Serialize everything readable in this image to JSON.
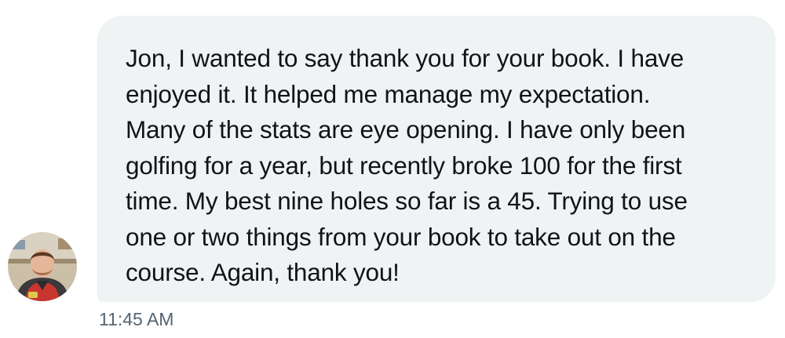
{
  "message": {
    "lines": [
      "Jon, I wanted to say thank you for your book. I have",
      "enjoyed it. It helped me manage my expectation.",
      "Many of the stats are eye opening. I have only been",
      "golfing for a year, but recently broke 100 for the first",
      "time. My best nine holes so far is a 45. Trying to use",
      "one or two things from your book to take out on the",
      "course. Again, thank you!"
    ],
    "timestamp": "11:45 AM"
  },
  "colors": {
    "bubble_background": "#eff3f4",
    "text": "#0f1419",
    "timestamp": "#536471"
  },
  "avatar": {
    "icon": "user-avatar-photo"
  }
}
